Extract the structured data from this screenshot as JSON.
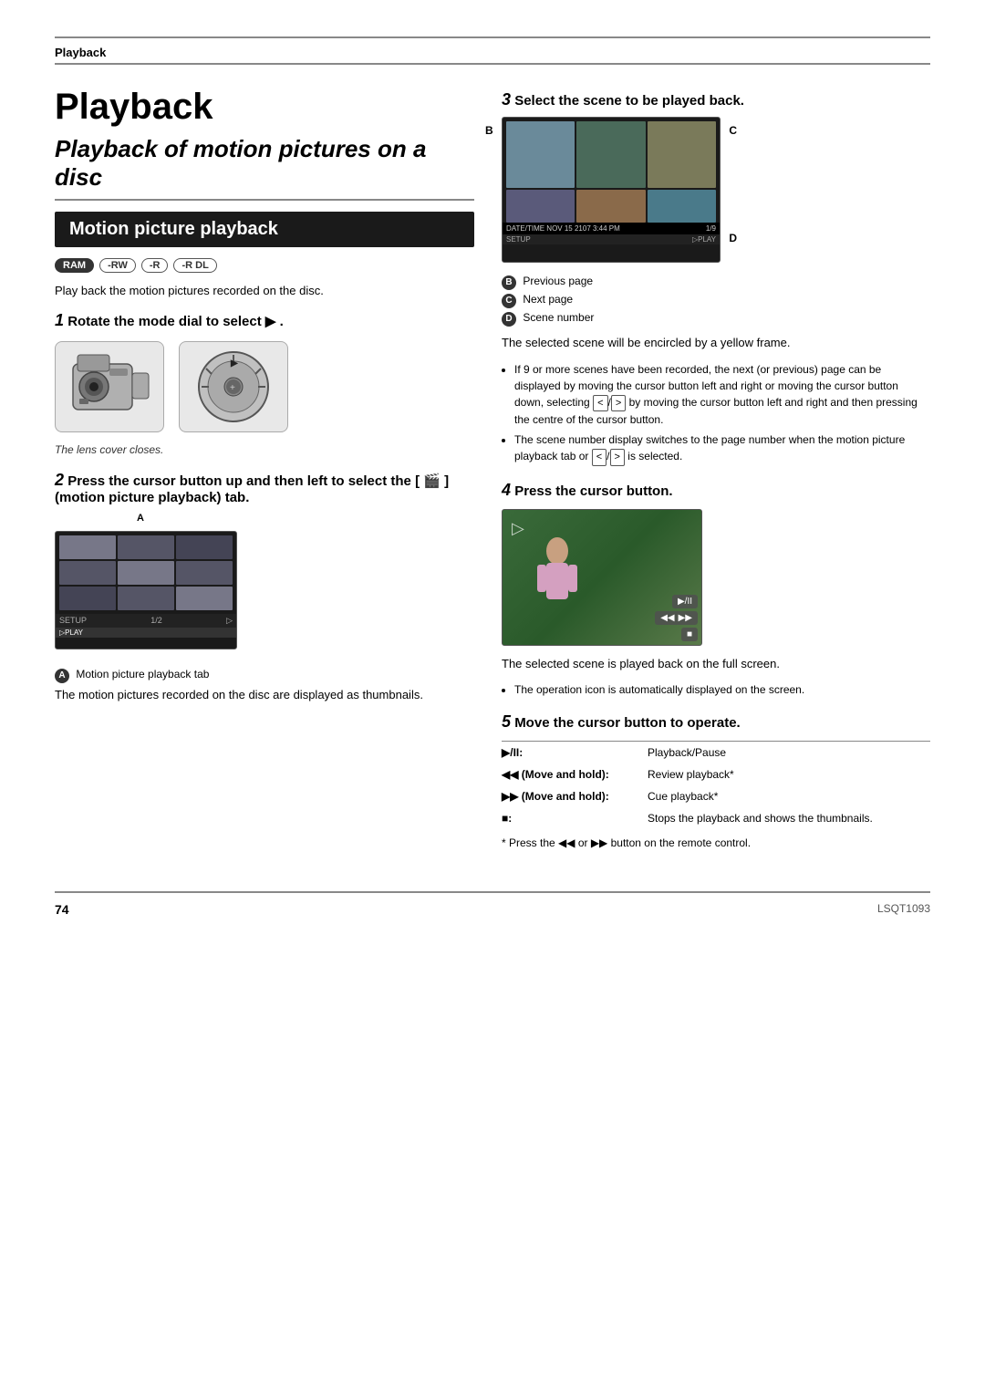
{
  "page": {
    "section_label": "Playback",
    "title": "Playback",
    "subtitle": "Playback of motion pictures on a disc",
    "motion_header": "Motion picture playback",
    "badges": [
      "RAM",
      "-RW",
      "-R",
      "-R DL"
    ],
    "intro_text": "Play back the motion pictures recorded on the disc.",
    "step1": {
      "num": "1",
      "heading": "Rotate the mode dial to select",
      "heading2": "▶ .",
      "caption": "The lens cover closes."
    },
    "step2": {
      "num": "2",
      "heading": "Press the cursor button up and then left to select the [ 🎬 ] (motion picture playback) tab.",
      "label_a": "A",
      "caption_a": "Motion picture playback tab",
      "caption_a2": "The motion pictures recorded on the disc are displayed as thumbnails.",
      "screen_bar_left": "SETUP",
      "screen_bar_mid": "1/2",
      "screen_bar_right": "▷"
    },
    "step3": {
      "num": "3",
      "heading": "Select the scene to be played back.",
      "label_b": "B",
      "label_c": "C",
      "label_d": "D",
      "info_b": "Previous page",
      "info_c": "Next page",
      "info_d": "Scene number",
      "selected_text": "The selected scene will be encircled by a yellow frame.",
      "bullet1": "If 9 or more scenes have been recorded, the next (or previous) page can be displayed by moving the cursor button left and right or moving the cursor button down, selecting [  <  ]/[  >  ] by moving the cursor button left and right and then pressing the centre of the cursor button.",
      "bullet2": "The scene number display switches to the page number when the motion picture playback tab or [  <  ]/[  >  ] is selected.",
      "screen_bar3_left": "DATE/TIME NOV 15 2107 3:44 PM",
      "screen_bar3_right": "1/9",
      "screen_bar3_b": "SETUP",
      "screen_bar3_play": "▷PLAY"
    },
    "step4": {
      "num": "4",
      "heading": "Press the cursor button.",
      "caption": "The selected scene is played back on the full screen.",
      "bullet1": "The operation icon is automatically displayed on the screen."
    },
    "step5": {
      "num": "5",
      "heading": "Move the cursor button to operate.",
      "ops": [
        {
          "key": "▶/II:",
          "val": "Playback/Pause"
        },
        {
          "key": "◀◀ (Move and hold):",
          "val": "Review playback*"
        },
        {
          "key": "▶▶ (Move and hold):",
          "val": "Cue playback*"
        },
        {
          "key": "■:",
          "val": "Stops the playback and shows the thumbnails."
        }
      ],
      "footnote": "* Press the ◀◀ or ▶▶ button on the remote control."
    },
    "footer": {
      "page_num": "74",
      "model": "LSQT1093"
    }
  }
}
